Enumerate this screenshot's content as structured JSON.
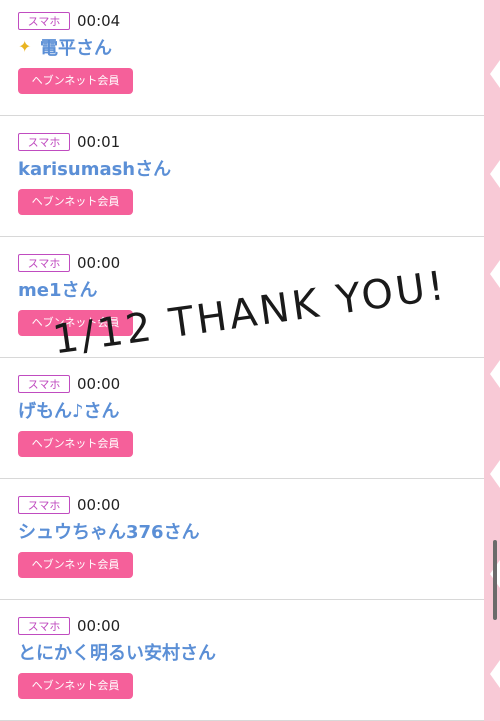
{
  "overlay": {
    "text": "1/12 THANK YOU!"
  },
  "items": [
    {
      "badge": "スマホ",
      "time": "00:04",
      "name": "電平さん",
      "member_label": "ヘブンネット会員"
    },
    {
      "badge": "スマホ",
      "time": "00:01",
      "name": "karisumashさん",
      "member_label": "ヘブンネット会員"
    },
    {
      "badge": "スマホ",
      "time": "00:00",
      "name": "me1さん",
      "member_label": "ヘブンネット会員"
    },
    {
      "badge": "スマホ",
      "time": "00:00",
      "name": "げもん♪さん",
      "member_label": "ヘブンネット会員"
    },
    {
      "badge": "スマホ",
      "time": "00:00",
      "name": "シュウちゃん376さん",
      "member_label": "ヘブンネット会員"
    },
    {
      "badge": "スマホ",
      "time": "00:00",
      "name": "とにかく明るい安村さん",
      "member_label": "ヘブンネット会員"
    }
  ],
  "colors": {
    "badge": "#c04cc0",
    "name": "#5b8fd6",
    "member_button": "#f5609a",
    "side_strip": "#f8c9d6"
  }
}
